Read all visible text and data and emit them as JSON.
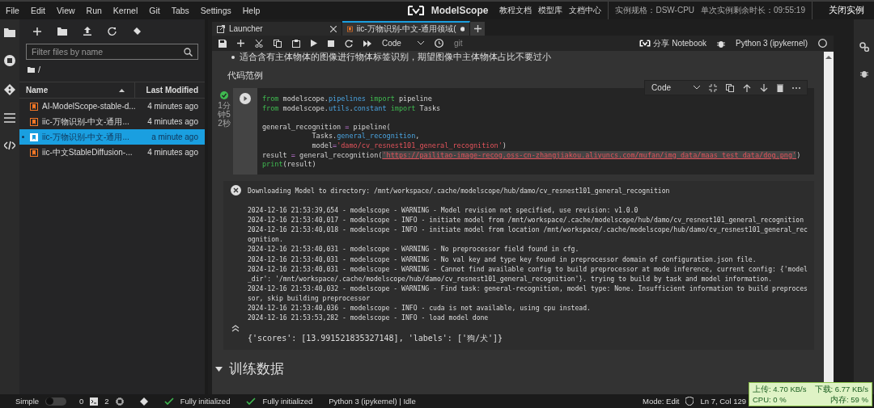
{
  "menu": [
    "File",
    "Edit",
    "View",
    "Run",
    "Kernel",
    "Git",
    "Tabs",
    "Settings",
    "Help"
  ],
  "header": {
    "logo": "ModelScope",
    "links": [
      "教程文档",
      "模型库",
      "文档中心"
    ],
    "spec": "实例规格：DSW-CPU",
    "remaining": "单次实例剩余时长：09:55:19",
    "close": "关闭实例"
  },
  "filebrowser": {
    "search": {
      "placeholder": "Filter files by name"
    },
    "path": "/",
    "columns": [
      "Name",
      "Last Modified"
    ],
    "files": [
      {
        "name": "AI-ModelScope-stable-d...",
        "modified": "4 minutes ago",
        "selected": false
      },
      {
        "name": "iic-万物识别-中文-通用...",
        "modified": "4 minutes ago",
        "selected": false
      },
      {
        "name": "iic-万物识别-中文-通用...",
        "modified": "a minute ago",
        "selected": true
      },
      {
        "name": "iic-中文StableDiffusion-...",
        "modified": "4 minutes ago",
        "selected": false
      }
    ]
  },
  "tabs": [
    {
      "label": "Launcher",
      "selected": false
    },
    {
      "label": "iic-万物识别-中文-通用领域(",
      "selected": true
    }
  ],
  "toolbar": {
    "cell_type": "Code",
    "git": "git",
    "share": "分享 Notebook",
    "kernel": "Python 3 (ipykernel)"
  },
  "notebook": {
    "bullet": "适合含有主体物体的图像进行物体标签识别，期望图像中主体物体占比不要过小",
    "heading": "代码范例",
    "cell_type": "Code",
    "exec_time": "1分钟52秒",
    "code": [
      [
        [
          {
            "t": "from",
            "kind": "kw"
          },
          {
            "t": " modelscope.",
            "kind": "plain"
          },
          {
            "t": "pipelines",
            "kind": "attr"
          },
          {
            "t": " import",
            "kind": "kw"
          },
          {
            "t": " pipeline",
            "kind": "plain"
          }
        ],
        [
          {
            "t": "from",
            "kind": "kw"
          },
          {
            "t": " modelscope.",
            "kind": "plain"
          },
          {
            "t": "utils",
            "kind": "attr"
          },
          {
            "t": ".",
            "kind": "plain"
          },
          {
            "t": "constant",
            "kind": "attr"
          },
          {
            "t": " import",
            "kind": "kw"
          },
          {
            "t": " Tasks",
            "kind": "plain"
          }
        ]
      ],
      [
        [
          {
            "t": "general_recognition ",
            "kind": "plain"
          },
          {
            "t": "=",
            "kind": "op"
          },
          {
            "t": " pipeline(",
            "kind": "plain"
          }
        ],
        [
          {
            "t": "            Tasks.",
            "kind": "plain"
          },
          {
            "t": "general_recognition",
            "kind": "attr"
          },
          {
            "t": ",",
            "kind": "plain"
          }
        ],
        [
          {
            "t": "            model",
            "kind": "plain"
          },
          {
            "t": "=",
            "kind": "op"
          },
          {
            "t": "'damo/cv_resnest101_general_recognition'",
            "kind": "str"
          },
          {
            "t": ")",
            "kind": "plain"
          }
        ],
        [
          {
            "t": "result ",
            "kind": "plain"
          },
          {
            "t": "=",
            "kind": "op"
          },
          {
            "t": " general_recognition(",
            "kind": "plain"
          },
          {
            "t": "'https://pailitao-image-recog.oss-cn-zhangjiakou.aliyuncs.com/mufan/img_data/maas_test_data/dog.png'",
            "kind": "url"
          },
          {
            "t": ")",
            "kind": "plain"
          }
        ],
        [
          {
            "t": "print",
            "kind": "kw"
          },
          {
            "t": "(result)",
            "kind": "plain"
          }
        ]
      ]
    ],
    "output_header": "Downloading Model to directory: /mnt/workspace/.cache/modelscope/hub/damo/cv_resnest101_general_recognition",
    "output": [
      "2024-12-16 21:53:39,654 - modelscope - WARNING - Model revision not specified, use revision: v1.0.0",
      "2024-12-16 21:53:40,017 - modelscope - INFO - initiate model from /mnt/workspace/.cache/modelscope/hub/damo/cv_resnest101_general_recognition",
      "2024-12-16 21:53:40,018 - modelscope - INFO - initiate model from location /mnt/workspace/.cache/modelscope/hub/damo/cv_resnest101_general_recognition.",
      "2024-12-16 21:53:40,031 - modelscope - WARNING - No preprocessor field found in cfg.",
      "2024-12-16 21:53:40,031 - modelscope - WARNING - No val key and type key found in preprocessor domain of configuration.json file.",
      "2024-12-16 21:53:40,031 - modelscope - WARNING - Cannot find available config to build preprocessor at mode inference, current config: {'model_dir': '/mnt/workspace/.cache/modelscope/hub/damo/cv_resnest101_general_recognition'}. trying to build by task and model information.",
      "2024-12-16 21:53:40,032 - modelscope - WARNING - Find task: general-recognition, model type: None. Insufficient information to build preprocessor, skip building preprocessor",
      "2024-12-16 21:53:40,036 - modelscope - INFO - cuda is not available, using cpu instead.",
      "2024-12-16 21:53:53,282 - modelscope - INFO - load model done"
    ],
    "result": "{'scores': [13.991521835327148], 'labels': ['狗/犬']}",
    "section": "训练数据",
    "section_expanded": true
  },
  "status": {
    "mode_label": "Simple",
    "simple_on": false,
    "terminals": "0",
    "kernels": "2",
    "git_status": "Fully initialized",
    "lsp_status": "Fully initialized",
    "kernel": "Python 3 (ipykernel) | Idle",
    "mode": "Mode: Edit",
    "position": "Ln 7, Col 129"
  },
  "netspeed": {
    "upload": "上传: 4.70 KB/s",
    "download": "下载: 6.77 KB/s",
    "cpu": "CPU: 0 %",
    "memory": "内存: 59 %"
  }
}
